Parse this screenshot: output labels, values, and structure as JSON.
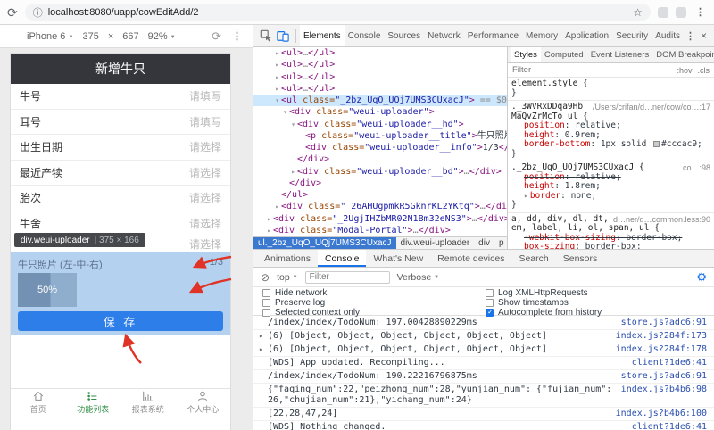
{
  "colors": {
    "accent": "#1a73e8",
    "highlight": "#b5d1f0",
    "save": "#2d7ee9",
    "annot": "#e03226",
    "tab-active": "#2f8f46",
    "sel": "#cde8fd",
    "crumb": "#3b79d1",
    "header": "#35363b"
  },
  "browser": {
    "url": "localhost:8080/uapp/cowEditAdd/2"
  },
  "device_toolbar": {
    "device": "iPhone 6",
    "width": "375",
    "times": "×",
    "height": "667",
    "zoom": "92%"
  },
  "phone": {
    "header_title": "新增牛只",
    "form_rows": [
      {
        "label": "牛号",
        "value": "请填写"
      },
      {
        "label": "耳号",
        "value": "请填写"
      },
      {
        "label": "出生日期",
        "value": "请选择"
      },
      {
        "label": "最近产犊",
        "value": "请选择"
      },
      {
        "label": "胎次",
        "value": "请选择"
      },
      {
        "label": "牛舍",
        "value": "请选择"
      },
      {
        "label": "",
        "value": "请选择"
      }
    ],
    "inspect_tooltip": {
      "selector": "div.weui-uploader",
      "divider": "|",
      "dims": "375 × 166"
    },
    "uploader": {
      "title": "牛只照片 (左-中-右)",
      "count": "1/3",
      "progress": "50%"
    },
    "save_button_label": "保 存",
    "tabbar": [
      {
        "label": "首页",
        "icon": "home-icon",
        "active": false
      },
      {
        "label": "功能列表",
        "icon": "list-icon",
        "active": true
      },
      {
        "label": "报表系统",
        "icon": "report-icon",
        "active": false
      },
      {
        "label": "个人中心",
        "icon": "profile-icon",
        "active": false
      }
    ]
  },
  "devtools": {
    "tabs": [
      "Elements",
      "Console",
      "Sources",
      "Network",
      "Performance",
      "Memory",
      "Application",
      "Security",
      "Audits"
    ],
    "selected_tab": "Elements",
    "tree": [
      {
        "i": 2,
        "ar": "c",
        "tk": [
          [
            "t",
            "<ul>"
          ],
          [
            "d",
            "…"
          ],
          [
            "t",
            "</ul>"
          ]
        ]
      },
      {
        "i": 2,
        "ar": "c",
        "tk": [
          [
            "t",
            "<ul>"
          ],
          [
            "d",
            "…"
          ],
          [
            "t",
            "</ul>"
          ]
        ]
      },
      {
        "i": 2,
        "ar": "c",
        "tk": [
          [
            "t",
            "<ul>"
          ],
          [
            "d",
            "…"
          ],
          [
            "t",
            "</ul>"
          ]
        ]
      },
      {
        "i": 2,
        "ar": "c",
        "tk": [
          [
            "t",
            "<ul>"
          ],
          [
            "d",
            "…"
          ],
          [
            "t",
            "</ul>"
          ]
        ]
      },
      {
        "i": 2,
        "ar": "o",
        "sel": true,
        "tk": [
          [
            "t",
            "<ul"
          ],
          [
            "a",
            " class="
          ],
          [
            "v",
            "\"_2bz_UqO_UQj7UMS3CUxacJ\""
          ],
          [
            "t",
            ">"
          ],
          [
            "d",
            " == $0"
          ]
        ]
      },
      {
        "i": 3,
        "ar": "o",
        "tk": [
          [
            "t",
            "<div"
          ],
          [
            "a",
            " class="
          ],
          [
            "v",
            "\"weui-uploader\""
          ],
          [
            "t",
            ">"
          ]
        ]
      },
      {
        "i": 4,
        "ar": "o",
        "tk": [
          [
            "t",
            "<div"
          ],
          [
            "a",
            " class="
          ],
          [
            "v",
            "\"weui-uploader__hd\""
          ],
          [
            "t",
            ">"
          ]
        ]
      },
      {
        "i": 5,
        "ar": "",
        "tk": [
          [
            "t",
            "<p"
          ],
          [
            "a",
            " class="
          ],
          [
            "v",
            "\"weui-uploader__title\""
          ],
          [
            "t",
            ">"
          ],
          [
            "x",
            "牛只照片 (左-中-右)"
          ],
          [
            "t",
            "</p>"
          ]
        ]
      },
      {
        "i": 5,
        "ar": "",
        "tk": [
          [
            "t",
            "<div"
          ],
          [
            "a",
            " class="
          ],
          [
            "v",
            "\"weui-uploader__info\""
          ],
          [
            "t",
            ">"
          ],
          [
            "x",
            "1/3"
          ],
          [
            "t",
            "</div>"
          ]
        ]
      },
      {
        "i": 4,
        "ar": "",
        "tk": [
          [
            "t",
            "</div>"
          ]
        ]
      },
      {
        "i": 4,
        "ar": "c",
        "tk": [
          [
            "t",
            "<div"
          ],
          [
            "a",
            " class="
          ],
          [
            "v",
            "\"weui-uploader__bd\""
          ],
          [
            "t",
            ">"
          ],
          [
            "d",
            "…"
          ],
          [
            "t",
            "</div>"
          ]
        ]
      },
      {
        "i": 3,
        "ar": "",
        "tk": [
          [
            "t",
            "</div>"
          ]
        ]
      },
      {
        "i": 2,
        "ar": "",
        "tk": [
          [
            "t",
            "</ul>"
          ]
        ]
      },
      {
        "i": 2,
        "ar": "c",
        "tk": [
          [
            "t",
            "<div"
          ],
          [
            "a",
            " class="
          ],
          [
            "v",
            "\"_26AHUgpmkR5GknrKL2YKtq\""
          ],
          [
            "t",
            ">"
          ],
          [
            "d",
            "…"
          ],
          [
            "t",
            "</div>"
          ]
        ]
      },
      {
        "i": 1,
        "ar": "c",
        "tk": [
          [
            "t",
            "<div"
          ],
          [
            "a",
            " class="
          ],
          [
            "v",
            "\"_2UgjIHZbMR02N1Bm32eNS3\""
          ],
          [
            "t",
            ">"
          ],
          [
            "d",
            "…"
          ],
          [
            "t",
            "</div>"
          ]
        ]
      },
      {
        "i": 1,
        "ar": "c",
        "tk": [
          [
            "t",
            "<div"
          ],
          [
            "a",
            " class="
          ],
          [
            "v",
            "\"Modal-Portal\""
          ],
          [
            "t",
            ">"
          ],
          [
            "d",
            "…"
          ],
          [
            "t",
            "</div>"
          ]
        ]
      }
    ],
    "breadcrumbs": [
      {
        "label": "ul._2bz_UqO_UQj7UMS3CUxacJ",
        "active": true
      },
      {
        "label": "div.weui-uploader",
        "active": false
      },
      {
        "label": "div",
        "active": false
      },
      {
        "label": "p",
        "active": false
      }
    ],
    "styles": {
      "tabs": [
        {
          "label": "Styles",
          "active": true
        },
        {
          "label": "Computed",
          "active": false
        },
        {
          "label": "Event Listeners",
          "active": false
        },
        {
          "label": "DOM Breakpoints",
          "active": false
        }
      ],
      "overflow_chevron": "»",
      "filter_placeholder": "Filter",
      "toggles": [
        ":hov",
        ".cls"
      ],
      "rules": [
        {
          "selector": "element.style",
          "link": "",
          "props": []
        },
        {
          "selector": "._3WVRxDDqa9Hb MaQvZrMcTo ul",
          "link": "/Users/crifan/d…ner/cow/co…:17",
          "props": [
            {
              "name": "position",
              "value": "relative"
            },
            {
              "name": "height",
              "value": "0.9rem"
            },
            {
              "name": "border-bottom",
              "value_pre": "1px solid ",
              "swatch": "#cccac9"
            }
          ]
        },
        {
          "selector": "._2bz_UqO_UQj7UMS3CUxacJ",
          "link": "co…:98",
          "props": [
            {
              "name": "position",
              "value": "relative",
              "struck": true
            },
            {
              "name": "height",
              "value": "1.8rem",
              "struck": true
            },
            {
              "name": "border",
              "value": "none",
              "expander": true
            }
          ]
        },
        {
          "selector": "a, dd, div, dl, dt, em, label, li, ol, span, ul",
          "link": "d…ner/d…common.less:90",
          "props": [
            {
              "name": "-webkit-box-sizing",
              "value": "border-box",
              "struck": true
            },
            {
              "name": "box-sizing",
              "value": "border-box"
            }
          ]
        }
      ]
    },
    "drawer": {
      "tabs": [
        {
          "label": "Animations",
          "active": false
        },
        {
          "label": "Console",
          "active": true
        },
        {
          "label": "What's New",
          "active": false
        },
        {
          "label": "Remote devices",
          "active": false
        },
        {
          "label": "Search",
          "active": false
        },
        {
          "label": "Sensors",
          "active": false
        }
      ],
      "context": "top",
      "filter_placeholder": "Filter",
      "level": "Verbose",
      "settings": [
        {
          "label": "Hide network",
          "checked": false
        },
        {
          "label": "Preserve log",
          "checked": false
        },
        {
          "label": "Selected context only",
          "checked": false
        },
        {
          "label": "Log XMLHttpRequests",
          "checked": false
        },
        {
          "label": "Show timestamps",
          "checked": false
        },
        {
          "label": "Autocomplete from history",
          "checked": true
        }
      ],
      "messages": [
        {
          "arrow": false,
          "text": "/index/index/TodoNum: 197.00428890229ms",
          "source": "store.js?adc6:91"
        },
        {
          "arrow": true,
          "text": "(6) [Object, Object, Object, Object, Object, Object]",
          "source": "index.js?284f:173"
        },
        {
          "arrow": true,
          "text": "(6) [Object, Object, Object, Object, Object, Object]",
          "source": "index.js?284f:178"
        },
        {
          "arrow": false,
          "text": "[WDS] App updated. Recompiling...",
          "source": "client?1de6:41"
        },
        {
          "arrow": false,
          "text": "/index/index/TodoNum: 190.22216796875ms",
          "source": "store.js?adc6:91"
        },
        {
          "arrow": false,
          "text": "{\"faqing_num\":22,\"peizhong_num\":28,\"yunjian_num\": {\"fujian_num\":26,\"chujian_num\":21},\"yichang_num\":24}",
          "source": "index.js?b4b6:98"
        },
        {
          "arrow": false,
          "text": "[22,28,47,24]",
          "source": "index.js?b4b6:100"
        },
        {
          "arrow": false,
          "text": "[WDS] Nothing changed.",
          "source": "client?1de6:41"
        }
      ]
    }
  }
}
